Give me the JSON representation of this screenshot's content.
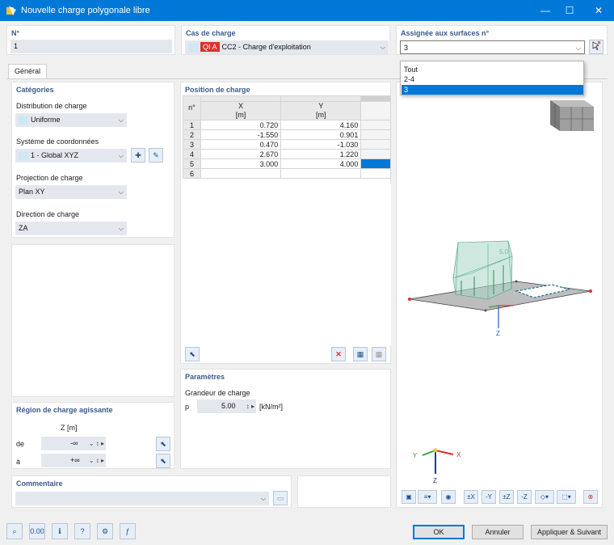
{
  "window": {
    "title": "Nouvelle charge polygonale libre",
    "minimize": "—",
    "maximize": "☐",
    "close": "✕"
  },
  "number": {
    "label": "N°",
    "value": "1"
  },
  "load_case": {
    "label": "Cas de charge",
    "badge": "QI A",
    "value": "CC2 - Charge d'exploitation",
    "badge_color": "#d9312b"
  },
  "assigned": {
    "label": "Assignée aux surfaces n°",
    "value": "3",
    "options": [
      "Tout",
      "2-4",
      "3"
    ],
    "selected": "3"
  },
  "tab": {
    "general": "Général"
  },
  "categories": {
    "title": "Catégories",
    "distribution_label": "Distribution de charge",
    "distribution_value": "Uniforme",
    "coord_label": "Système de coordonnées",
    "coord_value": "1 - Global XYZ",
    "projection_label": "Projection de charge",
    "projection_value": "Plan XY",
    "direction_label": "Direction de charge",
    "direction_value": "ZA"
  },
  "position": {
    "title": "Position de charge",
    "col_n": "n°",
    "col_x": "X",
    "col_x_unit": "[m]",
    "col_y": "Y",
    "col_y_unit": "[m]",
    "rows": [
      {
        "n": "1",
        "x": "0.720",
        "y": "4.160"
      },
      {
        "n": "2",
        "x": "-1.550",
        "y": "0.901"
      },
      {
        "n": "3",
        "x": "0.470",
        "y": "-1.030"
      },
      {
        "n": "4",
        "x": "2.670",
        "y": "1.220"
      },
      {
        "n": "5",
        "x": "3.000",
        "y": "4.000"
      },
      {
        "n": "6",
        "x": "",
        "y": ""
      }
    ]
  },
  "parameters": {
    "title": "Paramètres",
    "magnitude_label": "Grandeur de charge",
    "p_label": "p",
    "p_value": "5.00",
    "p_unit": "[kN/m²]"
  },
  "region": {
    "title": "Région de charge agissante",
    "z_header": "Z [m]",
    "from_label": "de",
    "from_value": "-∞",
    "to_label": "à",
    "to_value": "+∞"
  },
  "comment": {
    "title": "Commentaire",
    "value": ""
  },
  "view": {
    "label_value": "5.0",
    "axis_x": "X",
    "axis_y": "Y",
    "axis_z": "Z"
  },
  "buttons": {
    "ok": "OK",
    "cancel": "Annuler",
    "apply_next": "Appliquer & Suivant"
  }
}
